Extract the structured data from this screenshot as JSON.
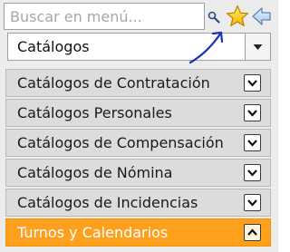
{
  "search": {
    "placeholder": "Buscar en menú..."
  },
  "icons": {
    "search": "magnifier-icon",
    "favorite": "star-icon",
    "back": "arrow-left-icon",
    "annotation": "blue-arrow-annotation"
  },
  "selector": {
    "value": "Catálogos"
  },
  "menu": {
    "items": [
      {
        "label": "Catálogos de Contratación",
        "state": "collapsed"
      },
      {
        "label": "Catálogos Personales",
        "state": "collapsed"
      },
      {
        "label": "Catálogos de Compensación",
        "state": "collapsed"
      },
      {
        "label": "Catálogos de Nómina",
        "state": "collapsed"
      },
      {
        "label": "Catálogos de Incidencias",
        "state": "collapsed"
      },
      {
        "label": "Turnos y Calendarios",
        "state": "expanded"
      }
    ]
  },
  "colors": {
    "accent": "#fda01d",
    "item_bg": "#dcdcdc",
    "annotation": "#1b2fbf"
  }
}
